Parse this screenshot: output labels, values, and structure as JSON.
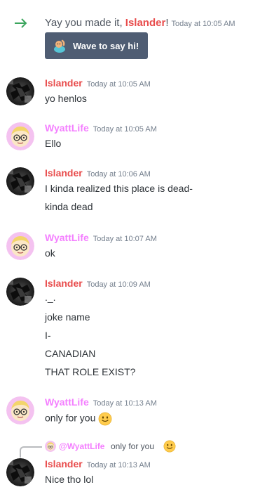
{
  "system_message": {
    "prefix": "Yay you made it, ",
    "name": "Islander",
    "suffix": "!",
    "timestamp": "Today at 10:05 AM",
    "wave_button_label": "Wave to say hi!",
    "arrow_icon": "arrow-right-icon"
  },
  "messages": [
    {
      "author": "Islander",
      "timestamp": "Today at 10:05 AM",
      "lines": [
        "yo henlos"
      ]
    },
    {
      "author": "WyattLife",
      "timestamp": "Today at 10:05 AM",
      "lines": [
        "Ello"
      ]
    },
    {
      "author": "Islander",
      "timestamp": "Today at 10:06 AM",
      "lines": [
        "I kinda realized this place is dead-",
        "kinda dead"
      ]
    },
    {
      "author": "WyattLife",
      "timestamp": "Today at 10:07 AM",
      "lines": [
        "ok"
      ]
    },
    {
      "author": "Islander",
      "timestamp": "Today at 10:09 AM",
      "lines": [
        "._.",
        "joke name",
        "I-",
        "CANADIAN",
        "THAT ROLE EXIST?"
      ]
    },
    {
      "author": "WyattLife",
      "timestamp": "Today at 10:13 AM",
      "lines": [
        "only for you"
      ],
      "emoji": "slightly-smiling-face"
    },
    {
      "author": "Islander",
      "timestamp": "Today at 10:13 AM",
      "lines": [
        "Nice tho lol"
      ]
    }
  ],
  "reply": {
    "mention": "@WyattLife",
    "text": "only for you",
    "emoji": "slightly-smiling-face"
  },
  "colors": {
    "islander": "#e84c4c",
    "wyattlife": "#f47fff",
    "timestamp": "#747f8d",
    "text": "#2e3338",
    "wave_button": "#4f5d73",
    "arrow": "#3ba55d"
  }
}
